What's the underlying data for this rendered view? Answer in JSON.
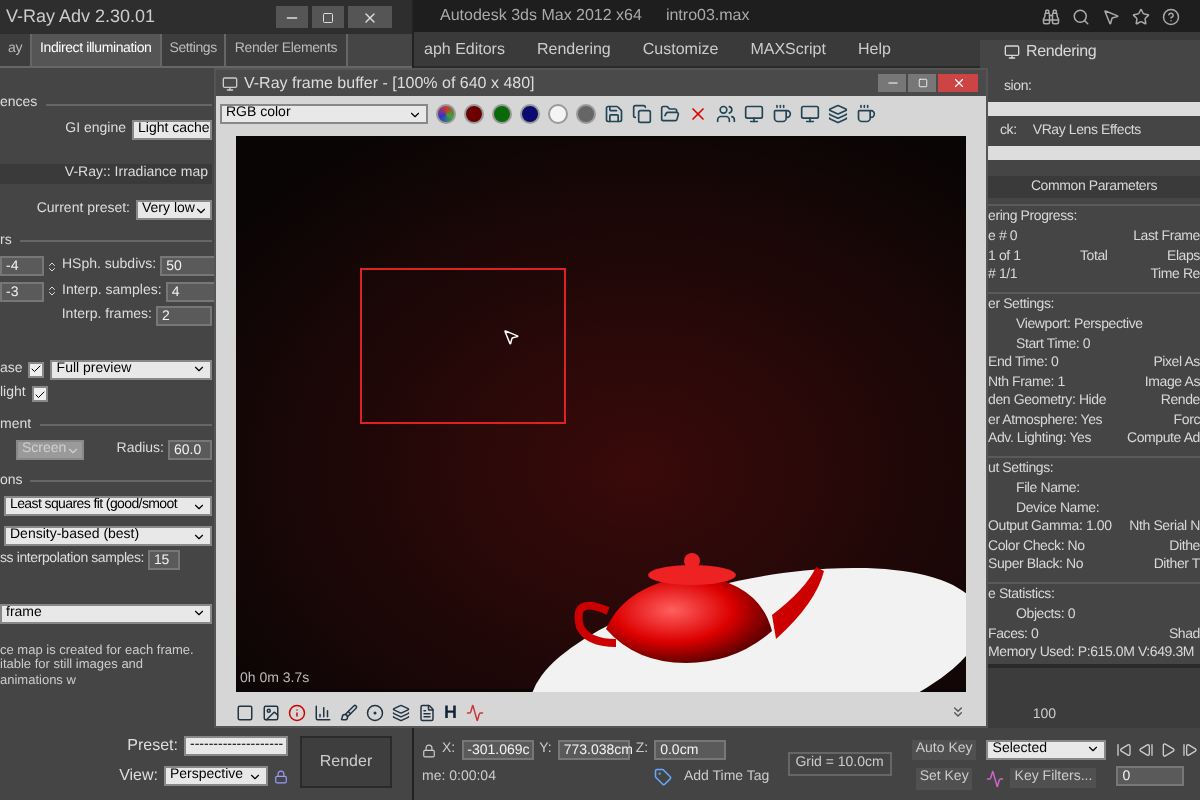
{
  "max_window": {
    "title": "Autodesk 3ds Max 2012 x64",
    "file_name": "intro03.max",
    "menu": [
      "aph Editors",
      "Rendering",
      "Customize",
      "MAXScript",
      "Help"
    ]
  },
  "render_setup": {
    "title": "V-Ray Adv 2.30.01",
    "tabs": [
      {
        "label": "ay",
        "selected": false
      },
      {
        "label": "Indirect illumination",
        "selected": true
      },
      {
        "label": "Settings",
        "selected": false
      },
      {
        "label": "Render Elements",
        "selected": false
      }
    ],
    "group_1": "ences",
    "gi_engine": {
      "label": "GI engine",
      "value": "Light cache"
    },
    "rollout": "V-Ray:: Irradiance map",
    "preset": {
      "label": "Current preset:",
      "value": "Very low"
    },
    "group_2": "rs",
    "params": [
      {
        "spinner": "-4",
        "label": "HSph. subdivs:",
        "value": "50"
      },
      {
        "spinner": "-3",
        "label": "Interp. samples:",
        "value": "4"
      },
      {
        "label": "Interp. frames:",
        "value": "2"
      }
    ],
    "options": [
      {
        "label": "ase",
        "checked": true
      },
      {
        "label": "light",
        "checked": true
      }
    ],
    "mode": "Full preview",
    "group_3": "ment",
    "screen": {
      "value": "Screen",
      "disabled": true
    },
    "radius": {
      "label": "Radius:",
      "value": "60.0"
    },
    "group_4": "ons",
    "interpolation": "Least squares fit (good/smoot",
    "lookup": "Density-based (best)",
    "samples": {
      "label": "ss interpolation samples:",
      "value": "15"
    },
    "frame_mode": "frame",
    "description": "ce map is created for each frame. itable for still images and animations w",
    "bottom_preset": {
      "label": "Preset:",
      "value": "--------------------"
    },
    "view": {
      "label": "View:",
      "value": "Perspective"
    },
    "render_button": "Render"
  },
  "frame_buffer": {
    "title": "V-Ray frame buffer - [100% of 640 x 480]",
    "channel": "RGB color",
    "render_time": "0h 0m 3.7s",
    "toolbar_glyph": "H"
  },
  "rendering_panel": {
    "title": "Rendering",
    "row_1": "sion:",
    "row_2": {
      "label": "ck:",
      "value": "VRay Lens Effects"
    },
    "rollout": "Common Parameters",
    "sections": [
      {
        "title": "ering Progress:",
        "lines": [
          [
            "e # 0",
            "Last Frame"
          ],
          [
            "1 of 1",
            "Total",
            "Elaps"
          ],
          [
            "# 1/1",
            "Time Re"
          ]
        ]
      },
      {
        "title": "er Settings:",
        "lines": [
          [
            "Viewport: Perspective"
          ],
          [
            "Start Time: 0"
          ],
          [
            "End Time: 0",
            "Pixel As"
          ],
          [
            "Nth Frame: 1",
            "Image As"
          ],
          [
            "den Geometry: Hide",
            "Rende"
          ],
          [
            "er Atmosphere: Yes",
            "Forc"
          ],
          [
            "Adv. Lighting: Yes",
            "Compute Ad"
          ]
        ]
      },
      {
        "title": "ut Settings:",
        "lines": [
          [
            "File Name:"
          ],
          [
            "Device Name:"
          ],
          [
            "Output Gamma: 1.00",
            "Nth Serial N"
          ],
          [
            "Color Check: No",
            "Dithe"
          ],
          [
            "Super Black: No",
            "Dither T"
          ]
        ]
      },
      {
        "title": "e Statistics:",
        "lines": [
          [
            "Objects: 0"
          ],
          [
            "Faces: 0",
            "Shad"
          ],
          [
            "Memory Used: P:615.0M V:649.3M"
          ]
        ]
      }
    ]
  },
  "timeline": {
    "end_label": "100"
  },
  "status_bar": {
    "coords": [
      {
        "axis": "X:",
        "value": "-301.069c"
      },
      {
        "axis": "Y:",
        "value": "773.038cm"
      },
      {
        "axis": "Z:",
        "value": "0.0cm"
      }
    ],
    "grid": "Grid = 10.0cm",
    "time": "me: 0:00:04",
    "add_time_tag": "Add Time Tag",
    "auto_key": "Auto Key",
    "key_mode": "Selected",
    "set_key": "Set Key",
    "key_filters": "Key Filters...",
    "frame": "0"
  }
}
